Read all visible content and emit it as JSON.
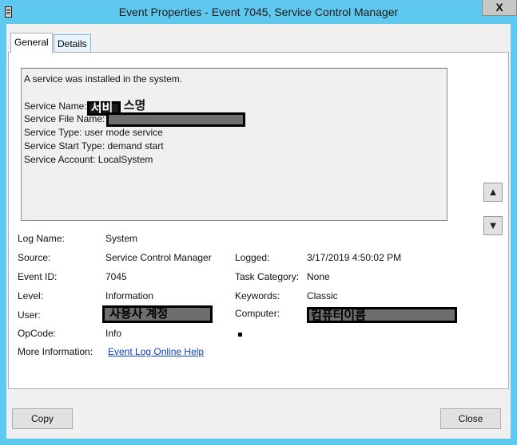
{
  "window": {
    "title": "Event Properties - Event 7045, Service Control Manager",
    "close_label": "X"
  },
  "tabs": [
    {
      "label": "General",
      "selected": true
    },
    {
      "label": "Details",
      "selected": false
    }
  ],
  "description": {
    "intro": "A service was installed in the system.",
    "service_name_label": "Service Name:",
    "service_name_value_visible": "서비",
    "service_name_value_rest": "스명",
    "service_file_label": "Service File Name:",
    "service_type": "Service Type:  user mode service",
    "service_start_type": "Service Start Type:  demand start",
    "service_account": "Service Account:  LocalSystem"
  },
  "scroll_buttons": {
    "up": "▲",
    "down": "▼"
  },
  "details": {
    "log_name": {
      "label": "Log Name:",
      "value": "System"
    },
    "source": {
      "label": "Source:",
      "value": "Service Control Manager"
    },
    "logged": {
      "label": "Logged:",
      "value": "3/17/2019 4:50:02 PM"
    },
    "event_id": {
      "label": "Event ID:",
      "value": "7045"
    },
    "task_category": {
      "label": "Task Category:",
      "value": "None"
    },
    "level": {
      "label": "Level:",
      "value": "Information"
    },
    "keywords": {
      "label": "Keywords:",
      "value": "Classic"
    },
    "user": {
      "label": "User:",
      "value": "사용사 계정"
    },
    "computer": {
      "label": "Computer:",
      "value": "컴퓨터이름"
    },
    "opcode": {
      "label": "OpCode:",
      "value": "Info"
    },
    "more_info": {
      "label": "More Information:",
      "link": "Event Log Online Help"
    }
  },
  "buttons": {
    "copy": "Copy",
    "close": "Close"
  }
}
